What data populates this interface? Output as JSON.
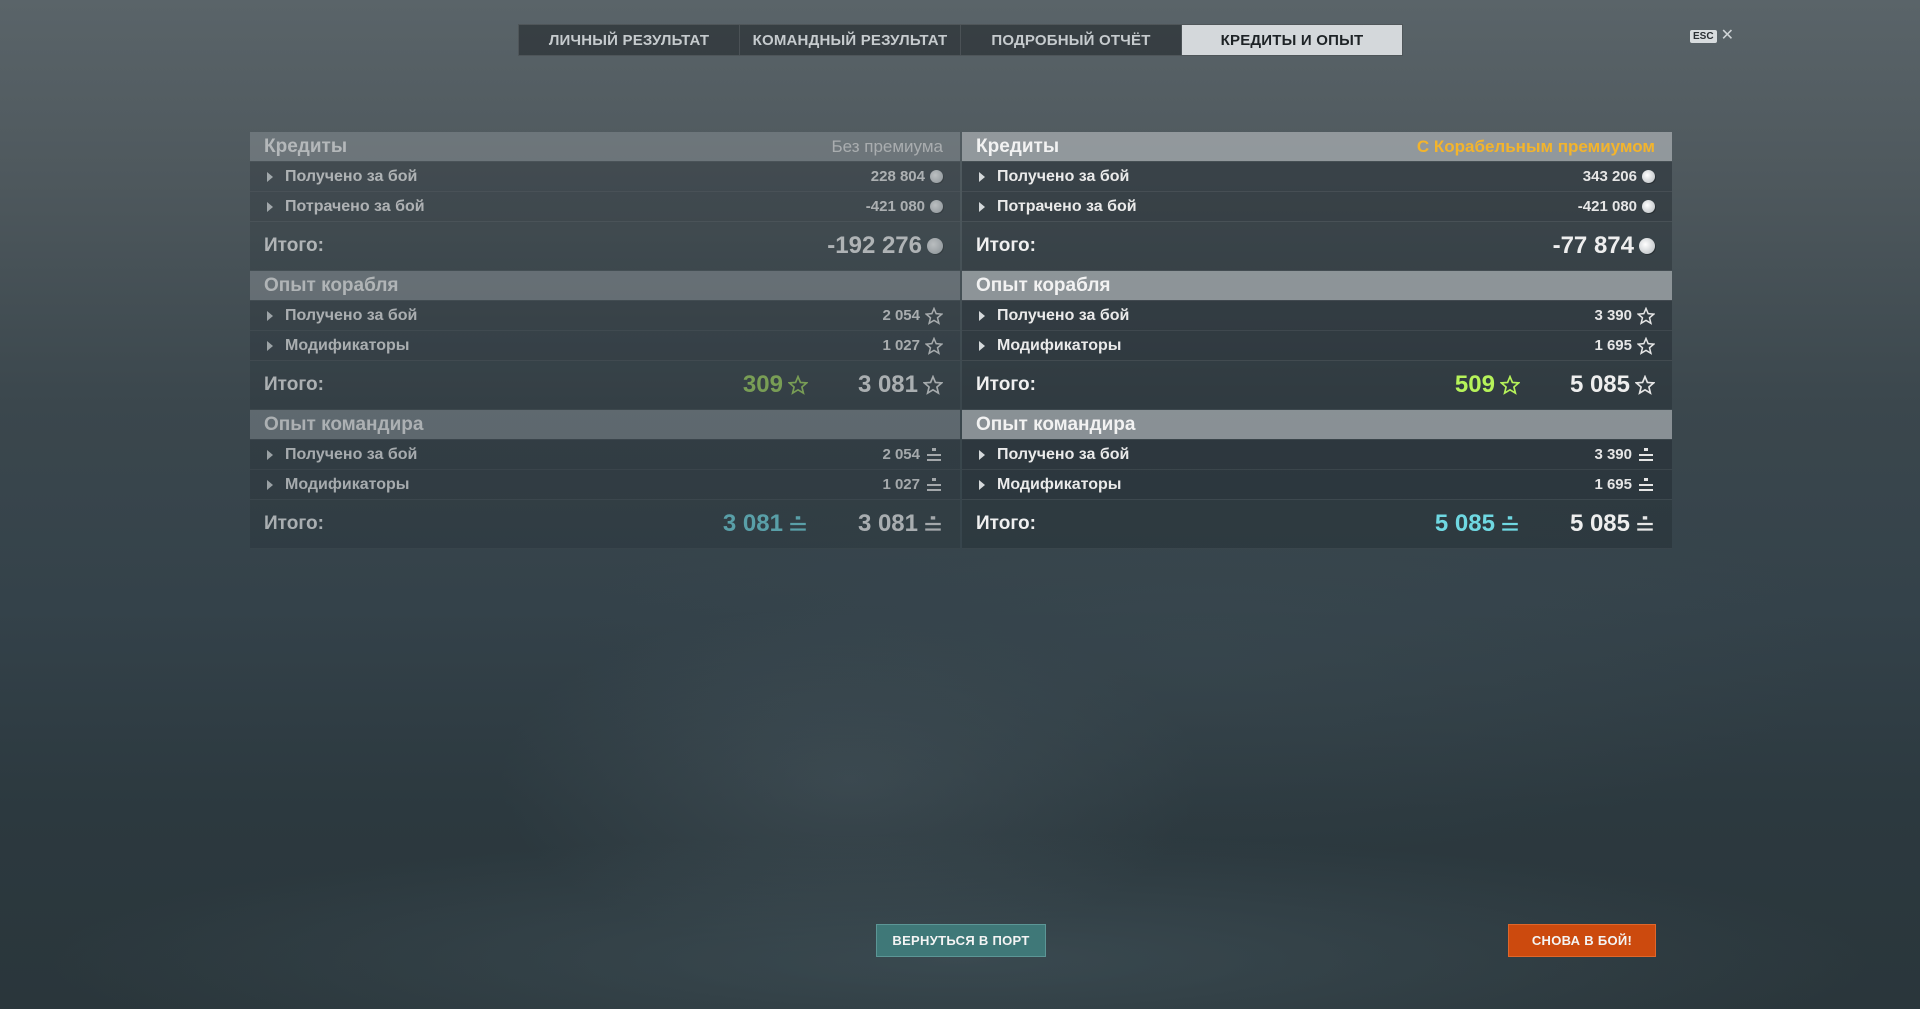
{
  "tabs": [
    {
      "label": "ЛИЧНЫЙ РЕЗУЛЬТАТ",
      "active": false
    },
    {
      "label": "КОМАНДНЫЙ РЕЗУЛЬТАТ",
      "active": false
    },
    {
      "label": "ПОДРОБНЫЙ ОТЧЁТ",
      "active": false
    },
    {
      "label": "КРЕДИТЫ И ОПЫТ",
      "active": true
    }
  ],
  "esc": {
    "key": "ESC",
    "close": "✕"
  },
  "left": {
    "credits": {
      "title": "Кредиты",
      "badge": "Без премиума",
      "rows": [
        {
          "label": "Получено за бой",
          "value": "228 804"
        },
        {
          "label": "Потрачено за бой",
          "value": "-421 080"
        }
      ],
      "total_label": "Итого:",
      "total": "-192 276"
    },
    "ship_xp": {
      "title": "Опыт корабля",
      "rows": [
        {
          "label": "Получено за бой",
          "value": "2 054"
        },
        {
          "label": "Модификаторы",
          "value": "1 027"
        }
      ],
      "total_label": "Итого:",
      "total_highlight": "309",
      "total": "3 081"
    },
    "commander_xp": {
      "title": "Опыт командира",
      "rows": [
        {
          "label": "Получено за бой",
          "value": "2 054"
        },
        {
          "label": "Модификаторы",
          "value": "1 027"
        }
      ],
      "total_label": "Итого:",
      "total_highlight": "3 081",
      "total": "3 081"
    }
  },
  "right": {
    "credits": {
      "title": "Кредиты",
      "badge": "С Корабельным премиумом",
      "rows": [
        {
          "label": "Получено за бой",
          "value": "343 206"
        },
        {
          "label": "Потрачено за бой",
          "value": "-421 080"
        }
      ],
      "total_label": "Итого:",
      "total": "-77 874"
    },
    "ship_xp": {
      "title": "Опыт корабля",
      "rows": [
        {
          "label": "Получено за бой",
          "value": "3 390"
        },
        {
          "label": "Модификаторы",
          "value": "1 695"
        }
      ],
      "total_label": "Итого:",
      "total_highlight": "509",
      "total": "5 085"
    },
    "commander_xp": {
      "title": "Опыт командира",
      "rows": [
        {
          "label": "Получено за бой",
          "value": "3 390"
        },
        {
          "label": "Модификаторы",
          "value": "1 695"
        }
      ],
      "total_label": "Итого:",
      "total_highlight": "5 085",
      "total": "5 085"
    }
  },
  "buttons": {
    "port": "ВЕРНУТЬСЯ В ПОРТ",
    "battle": "СНОВА В БОЙ!"
  },
  "colors": {
    "gold": "#f3b42c",
    "green": "#b6f25a",
    "cyan": "#6fd8e2",
    "port_btn": "#3f7878",
    "battle_btn": "#cc4a0e"
  },
  "icons": {
    "credits": "credit-coin-icon",
    "ship_xp": "star-icon",
    "commander_xp": "commander-xp-icon"
  }
}
